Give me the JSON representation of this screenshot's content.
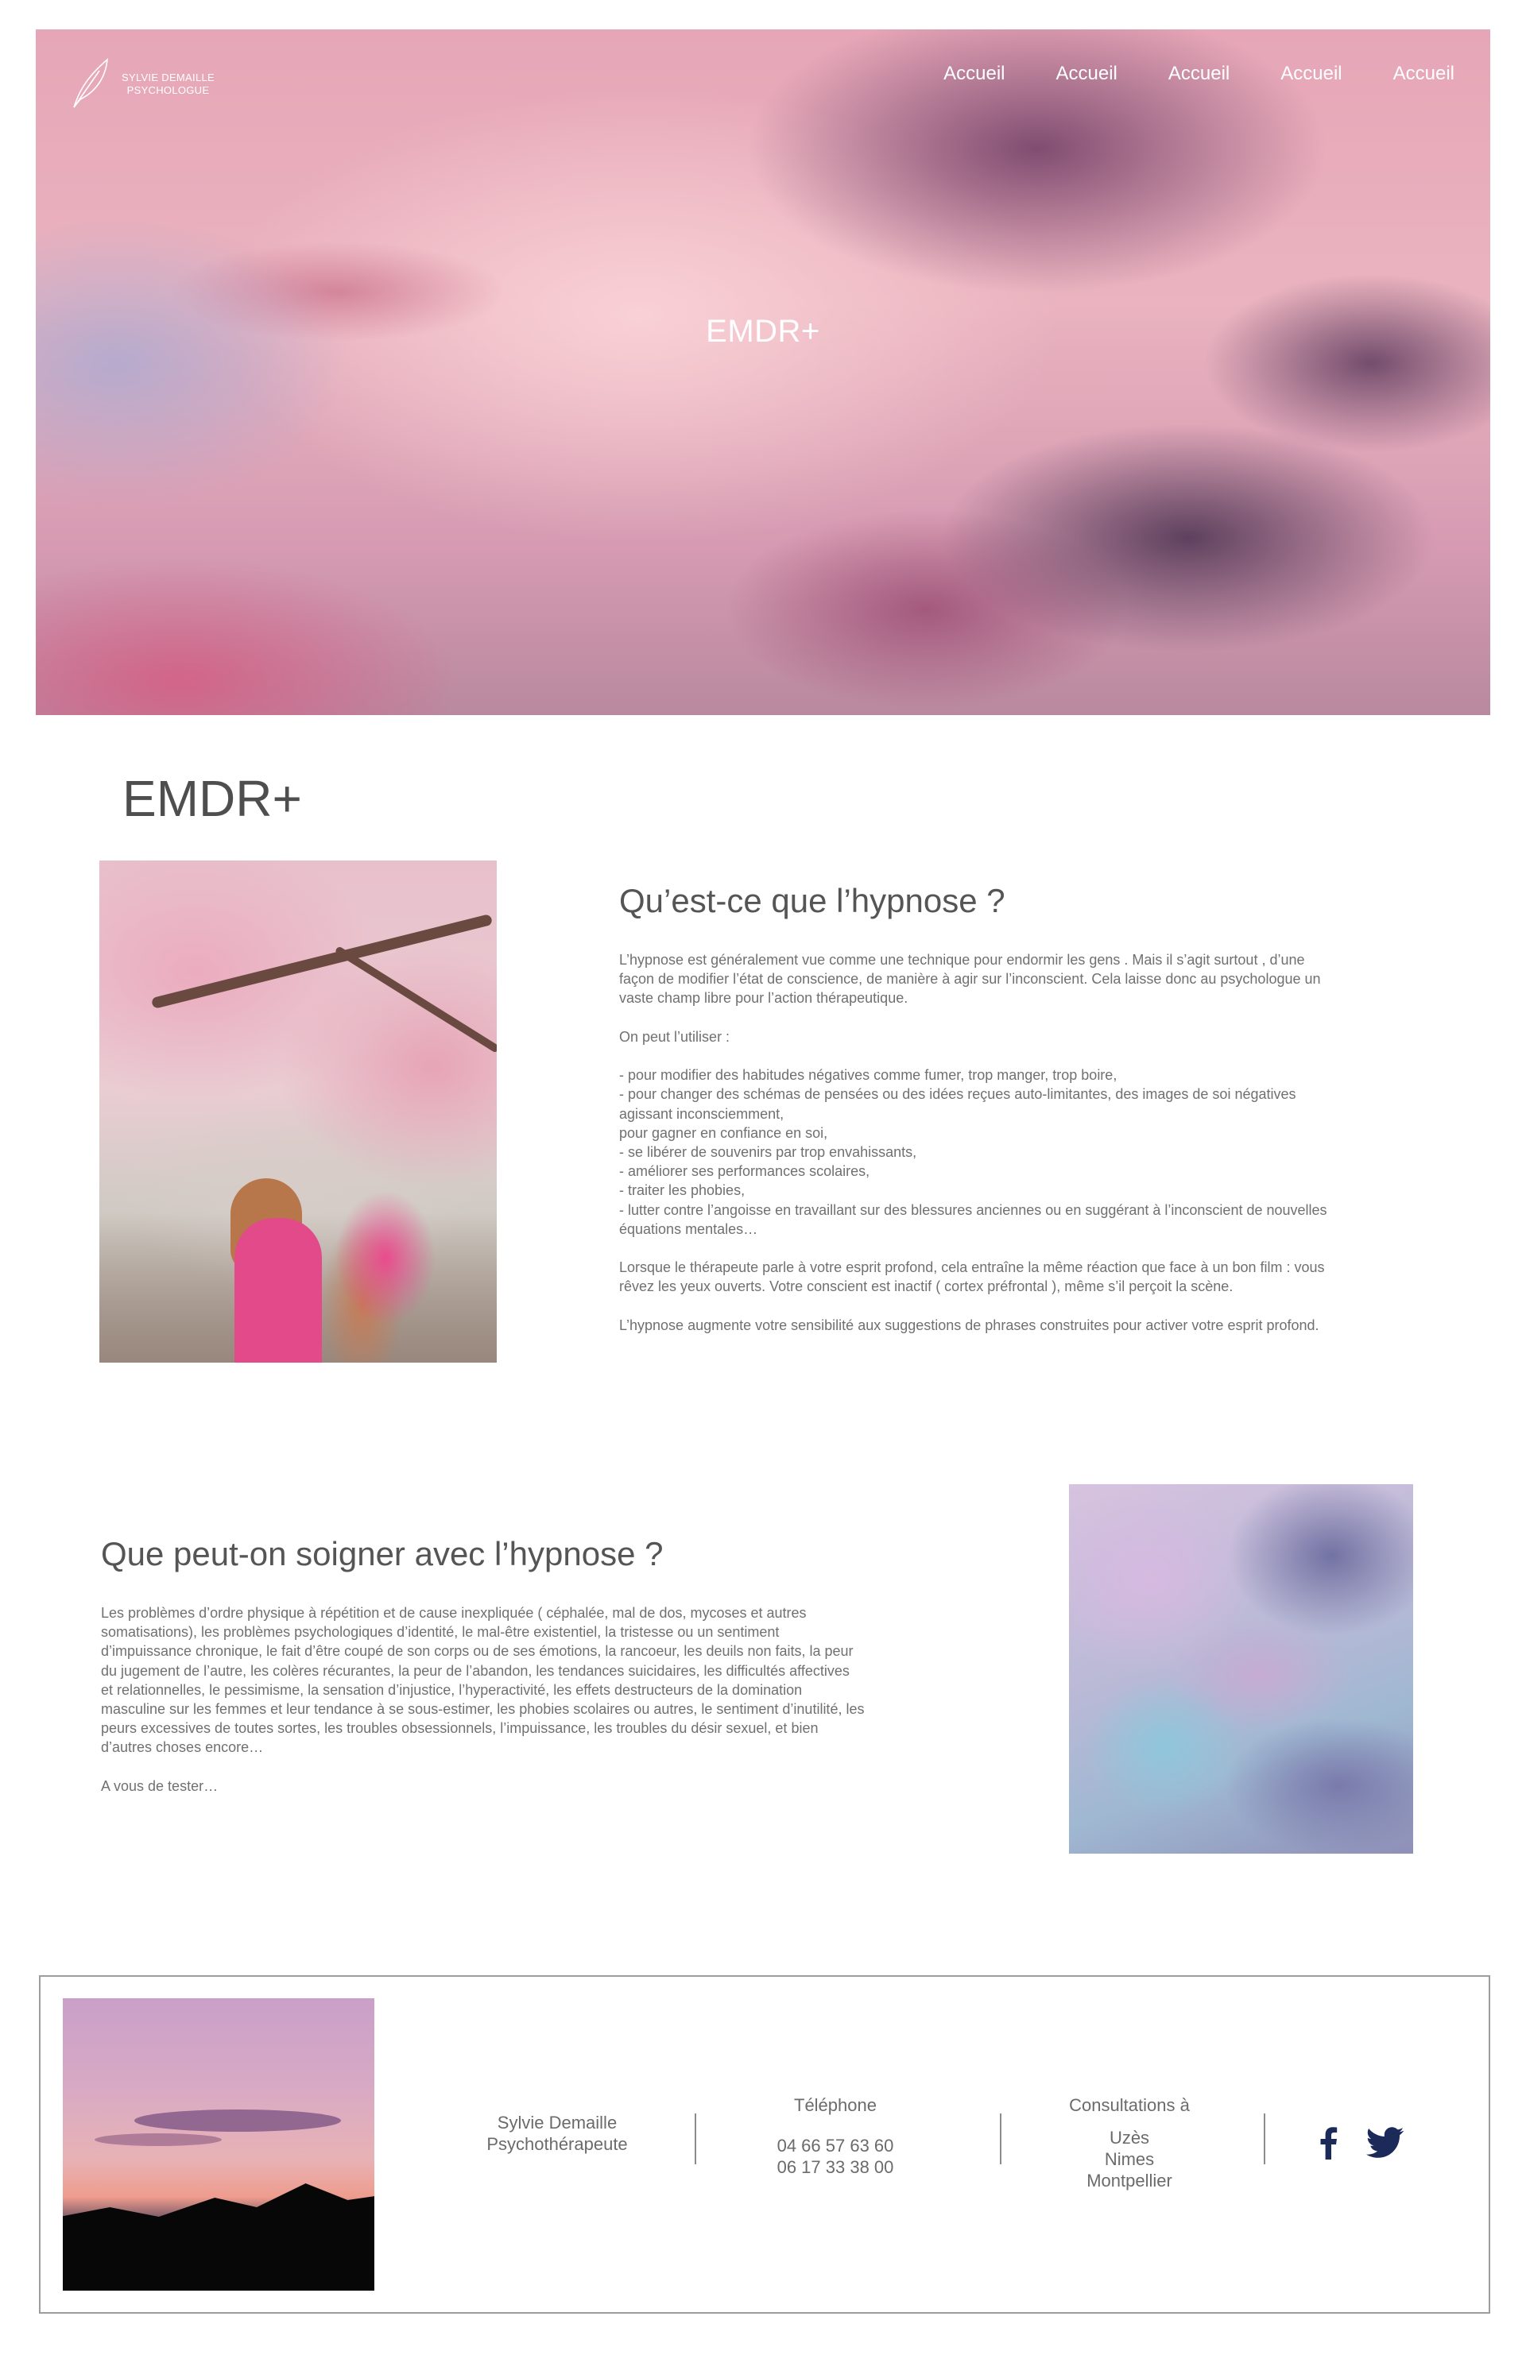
{
  "header": {
    "logo_line1": "SYLVIE DEMAILLE",
    "logo_line2": "PSYCHOLOGUE",
    "nav": [
      "Accueil",
      "Accueil",
      "Accueil",
      "Accueil",
      "Accueil"
    ]
  },
  "hero": {
    "title": "EMDR+"
  },
  "page": {
    "title": "EMDR+"
  },
  "section1": {
    "heading": "Qu’est-ce que l’hypnose ?",
    "lines": [
      "L’hypnose est généralement vue comme une technique pour endormir les gens . Mais il s’agit surtout , d’une",
      "façon de modifier l’état de conscience, de manière à agir sur l’inconscient. Cela laisse donc au psychologue un",
      "vaste champ libre pour l’action thérapeutique.",
      "",
      "On peut l’utiliser :",
      "",
      "- pour modifier des habitudes négatives comme fumer, trop manger, trop boire,",
      "- pour changer des schémas de pensées ou des idées reçues auto-limitantes, des images de soi négatives",
      "agissant inconsciemment,",
      "pour gagner en confiance en soi,",
      "- se libérer de souvenirs par trop envahissants,",
      "- améliorer ses performances scolaires,",
      "- traiter les phobies,",
      "- lutter contre l’angoisse en travaillant sur des blessures anciennes ou en suggérant à l’inconscient de nouvelles",
      "équations mentales…",
      "",
      "Lorsque le thérapeute parle à votre esprit profond, cela entraîne la même réaction que face à un bon film : vous",
      "rêvez les yeux ouverts. Votre conscient est inactif ( cortex préfrontal ), même s’il perçoit la scène.",
      "",
      "L’hypnose augmente votre sensibilité aux suggestions de phrases construites pour activer votre esprit profond."
    ]
  },
  "section2": {
    "heading": "Que peut-on soigner avec l’hypnose ?",
    "lines": [
      "Les problèmes d’ordre physique à répétition et de cause inexpliquée ( céphalée, mal de dos, mycoses et autres",
      "somatisations), les problèmes psychologiques d’identité, le mal-être existentiel, la tristesse ou un sentiment",
      "d’impuissance chronique, le fait d’être coupé de son corps ou de ses émotions, la rancoeur, les deuils non faits, la peur",
      "du jugement de l’autre, les colères récurantes, la peur de l’abandon, les tendances suicidaires, les difficultés affectives",
      "et relationnelles, le pessimisme, la sensation d’injustice, l’hyperactivité, les effets destructeurs de la domination",
      "masculine sur les femmes et leur tendance à se sous-estimer, les phobies scolaires ou autres, le sentiment d’inutilité, les",
      "peurs excessives de toutes sortes, les troubles obsessionnels, l’impuissance, les troubles du désir sexuel, et bien",
      "d’autres choses encore…",
      "",
      "A vous de tester…"
    ]
  },
  "footer": {
    "name": "Sylvie Demaille",
    "title": "Psychothérapeute",
    "phone_label": "Téléphone",
    "phones": [
      "04 66 57 63 60",
      "06 17 33 38 00"
    ],
    "consult_label": "Consultations à",
    "cities": [
      "Uzès",
      "Nimes",
      "Montpellier"
    ],
    "social_icons": [
      "facebook-icon",
      "twitter-icon"
    ],
    "icon_color": "#1c2a5a"
  }
}
